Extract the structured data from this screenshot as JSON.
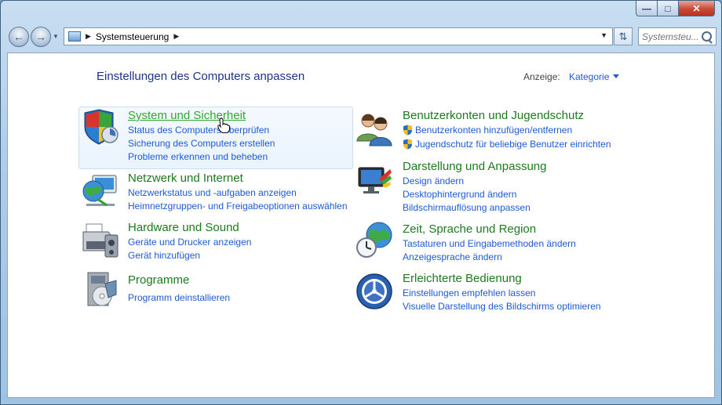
{
  "address": {
    "location": "Systemsteuerung"
  },
  "search": {
    "placeholder": "Systemsteu..."
  },
  "page": {
    "title": "Einstellungen des Computers anpassen"
  },
  "view": {
    "label": "Anzeige:",
    "value": "Kategorie"
  },
  "categories": [
    {
      "title": "System und Sicherheit",
      "links": [
        "Status des Computers überprüfen",
        "Sicherung des Computers erstellen",
        "Probleme erkennen und beheben"
      ]
    },
    {
      "title": "Netzwerk und Internet",
      "links": [
        "Netzwerkstatus und -aufgaben anzeigen",
        "Heimnetzgruppen- und Freigabeoptionen auswählen"
      ]
    },
    {
      "title": "Hardware und Sound",
      "links": [
        "Geräte und Drucker anzeigen",
        "Gerät hinzufügen"
      ]
    },
    {
      "title": "Programme",
      "links": [
        "Programm deinstallieren"
      ]
    },
    {
      "title": "Benutzerkonten und Jugendschutz",
      "links": [
        "Benutzerkonten hinzufügen/entfernen",
        "Jugendschutz für beliebige Benutzer einrichten"
      ]
    },
    {
      "title": "Darstellung und Anpassung",
      "links": [
        "Design ändern",
        "Desktophintergrund ändern",
        "Bildschirmauflösung anpassen"
      ]
    },
    {
      "title": "Zeit, Sprache und Region",
      "links": [
        "Tastaturen und Eingabemethoden ändern",
        "Anzeigesprache ändern"
      ]
    },
    {
      "title": "Erleichterte Bedienung",
      "links": [
        "Einstellungen empfehlen lassen",
        "Visuelle Darstellung des Bildschirms optimieren"
      ]
    }
  ]
}
